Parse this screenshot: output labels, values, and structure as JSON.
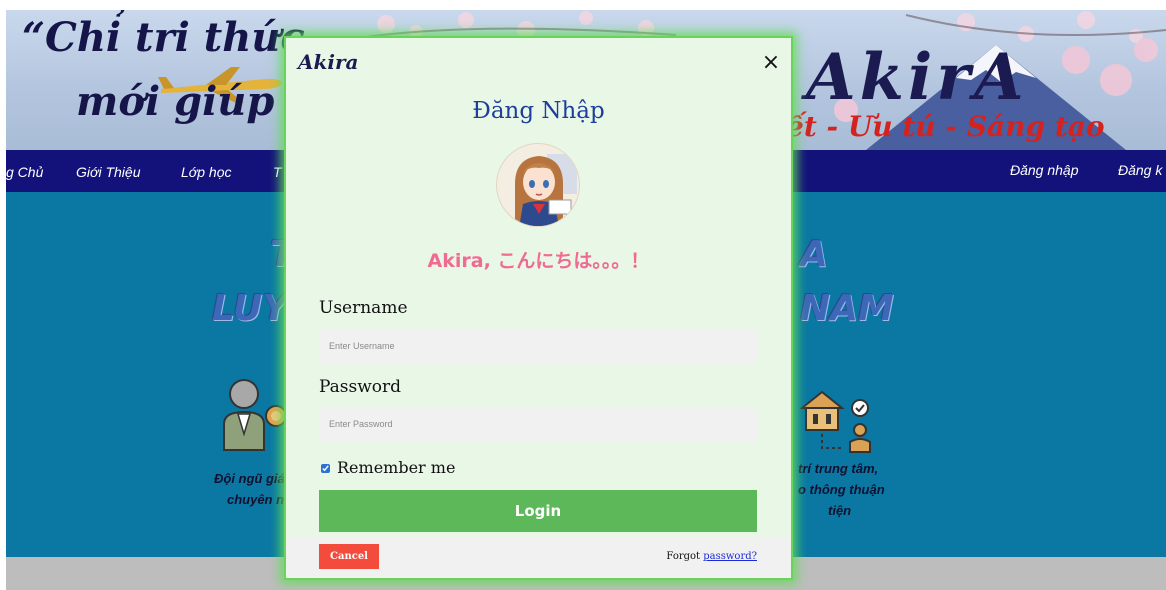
{
  "banner": {
    "slogan_line1": "“Chỉ tri thức",
    "slogan_line2": "mới giúp co",
    "slogan_line3": "ết - Ưu tú - Sáng tạo",
    "logo_text": "AkirA"
  },
  "navbar": {
    "items": [
      {
        "label": "g Chủ"
      },
      {
        "label": "Giới Thiệu"
      },
      {
        "label": "Lớp học"
      },
      {
        "label": "T"
      }
    ],
    "right_items": [
      {
        "label": "Đăng nhập"
      },
      {
        "label": "Đăng k"
      }
    ]
  },
  "main": {
    "heading_left_1": "T",
    "heading_left_2": "LUY",
    "heading_right_1": "A",
    "heading_right_2": "NAM",
    "feature_left_caption_1": "Đội ngũ giác",
    "feature_left_caption_2": "chuyên ng",
    "feature_right_caption_1": "trí trung tâm,",
    "feature_right_caption_2": "o thông thuận",
    "feature_right_caption_3": "tiện"
  },
  "modal": {
    "logo_text": "Akira",
    "title": "Đăng Nhập",
    "greeting": "Akira, こんにちは。。。！",
    "username_label": "Username",
    "username_placeholder": "Enter Username",
    "username_value": "",
    "password_label": "Password",
    "password_placeholder": "Enter Password",
    "password_value": "",
    "remember_label": "Remember me",
    "remember_checked": true,
    "login_label": "Login",
    "cancel_label": "Cancel",
    "forgot_prefix": "Forgot",
    "forgot_link": "password?"
  },
  "colors": {
    "navbar": "#13127a",
    "main_background": "#0a78a3",
    "modal_background": "#e9f7e7",
    "modal_border": "#6ad45a",
    "title": "#1c3f9c",
    "greeting": "#ef6b92",
    "login_button": "#5db85a",
    "cancel_button": "#f34b3c",
    "link": "#1a2bd6"
  },
  "icons": {
    "close": "close-icon",
    "avatar": "anime-girl-avatar",
    "feature_left": "teacher-award-icon",
    "feature_right": "building-location-icon"
  }
}
